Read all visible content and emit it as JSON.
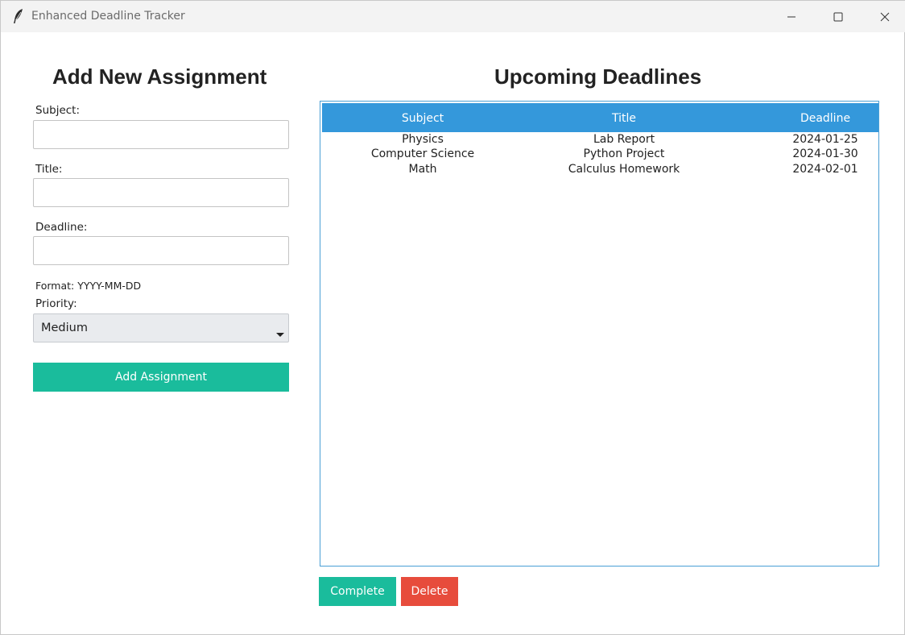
{
  "window": {
    "title": "Enhanced Deadline Tracker"
  },
  "form": {
    "heading": "Add New Assignment",
    "subject_label": "Subject:",
    "subject_value": "",
    "title_label": "Title:",
    "title_value": "",
    "deadline_label": "Deadline:",
    "deadline_value": "",
    "format_hint": "Format: YYYY-MM-DD",
    "priority_label": "Priority:",
    "priority_value": "Medium",
    "add_button": "Add Assignment"
  },
  "deadlines": {
    "heading": "Upcoming Deadlines",
    "columns": [
      "Subject",
      "Title",
      "Deadline"
    ],
    "rows": [
      {
        "subject": "Physics",
        "title": "Lab Report",
        "deadline": "2024-01-25"
      },
      {
        "subject": "Computer Science",
        "title": "Python Project",
        "deadline": "2024-01-30"
      },
      {
        "subject": "Math",
        "title": "Calculus Homework",
        "deadline": "2024-02-01"
      }
    ],
    "complete_button": "Complete",
    "delete_button": "Delete"
  },
  "colors": {
    "accent_green": "#1abc9c",
    "accent_blue": "#3498db",
    "danger_red": "#e74c3c"
  }
}
